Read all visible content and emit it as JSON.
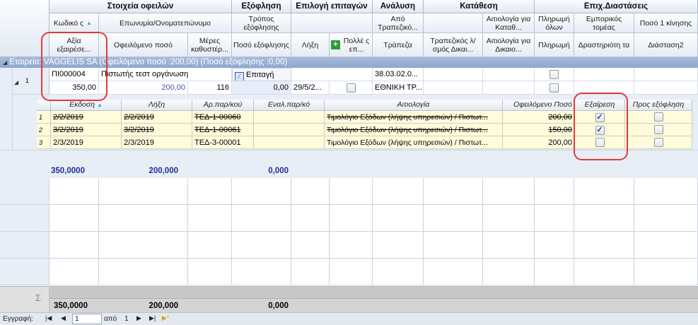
{
  "groups": [
    "Στοιχεία οφειλών",
    "Εξόφληση",
    "Επιλογή επιταγών",
    "Ανάλυση",
    "Κατάθεση",
    "Επιχ.Διαστάσεις"
  ],
  "cols1": [
    "Κωδικό ς",
    "Επωνυμία/Ονοματεπώνυμο",
    "Τρόπος εξόφλησης",
    "Από Τραπεζικό...",
    "Αιτιολογία για Καταθ...",
    "Πληρωμή όλων",
    "Εμπορικός τομέας",
    "Ποσό 1 κίνησης"
  ],
  "cols2": [
    "Αξία εξαιρέσε...",
    "Οφειλόμενο ποσό",
    "Μέρες καθυστέρ...",
    "Ποσό εξόφλησης",
    "Λήξη",
    "Πολλέ ς επ...",
    "Τράπεζα",
    "Τραπεζικός λ/σμός Δικαι...",
    "Αιτιολογία για Δικαιο...",
    "Πληρωμή",
    "Δραστηριότη τα",
    "Διάσταση2"
  ],
  "group_row": "Εταιρεία: VAGGELIS SA (Οφειλόμενο ποσό :200,00) (Ποσό εξόφλησης :0,00)",
  "main_row": {
    "num": "1",
    "code": "ΠΙ000004",
    "name": "Πιστωτής τεστ οργάνωση",
    "method": "Επιταγή",
    "from_bank": "38.03.02.0...",
    "excl_value": "350,00",
    "owed": "200,00",
    "days": "116",
    "paid": "0,00",
    "due": "29/5/2...",
    "bank": "ΕΘΝΙΚΗ ΤΡ..."
  },
  "detail_headers": [
    "Εκδοση",
    "Λήξη",
    "Αρ.παρ/κού",
    "Εναλ.παρ/κό",
    "Αιτιολογία",
    "Οφειλόμενο Ποσό",
    "Εξαίρεση",
    "Προς εξόφληση"
  ],
  "detail_rows": [
    {
      "n": "1",
      "issue": "2/2/2019",
      "due": "2/2/2019",
      "doc": "ΤΕΔ-1-00060",
      "alt": "",
      "reason": "Τιμολόγιο Εξόδων (λήψης υπηρεσιών) / Πιστωτ...",
      "amount": "200,00",
      "excluded": true,
      "strike": true
    },
    {
      "n": "2",
      "issue": "3/2/2019",
      "due": "3/2/2019",
      "doc": "ΤΕΔ-1-00061",
      "alt": "",
      "reason": "Τιμολόγιο Εξόδων (λήψης υπηρεσιών) / Πιστωτ...",
      "amount": "150,00",
      "excluded": true,
      "strike": true
    },
    {
      "n": "3",
      "issue": "2/3/2019",
      "due": "2/3/2019",
      "doc": "ΤΕΔ-3-00001",
      "alt": "",
      "reason": "Τιμολόγιο Εξόδων (λήψης υπηρεσιών) / Πιστωτ...",
      "amount": "200,00",
      "excluded": false,
      "strike": false
    }
  ],
  "group_totals": {
    "excl": "350,0000",
    "owed": "200,000",
    "paid": "0,000"
  },
  "footer_totals": {
    "excl": "350,0000",
    "owed": "200,000",
    "paid": "0,000"
  },
  "sigma": "Σ",
  "nav": {
    "label": "Εγγραφή:",
    "current": "1",
    "of": "από",
    "total": "1"
  }
}
